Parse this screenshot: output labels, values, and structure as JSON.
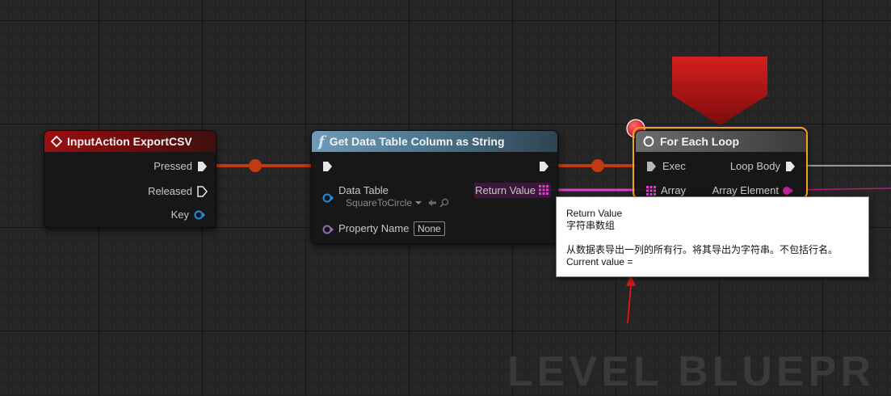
{
  "nodes": {
    "input_action": {
      "title": "InputAction ExportCSV",
      "pins": {
        "pressed": "Pressed",
        "released": "Released",
        "key": "Key"
      }
    },
    "get_column": {
      "title": "Get Data Table Column as String",
      "pins": {
        "data_table": "Data Table",
        "return_value": "Return Value",
        "property_name": "Property Name"
      },
      "data_table_value": "SquareToCircle",
      "property_name_value": "None"
    },
    "for_each": {
      "title": "For Each Loop",
      "pins": {
        "exec": "Exec",
        "loop_body": "Loop Body",
        "array": "Array",
        "array_element": "Array Element"
      }
    }
  },
  "tooltip": {
    "line1": "Return Value",
    "line2": "字符串数组",
    "line3": "从数据表导出一列的所有行。将其导出为字符串。不包括行名。",
    "line4": "Current value ="
  },
  "watermark": "LEVEL BLUEPR",
  "colors": {
    "exec_wire": "#c23a10",
    "string_array_wire": "#e040d0",
    "selection": "#f2a31a",
    "breakpoint": "#e0162a",
    "annotation_arrow": "#d41818"
  }
}
